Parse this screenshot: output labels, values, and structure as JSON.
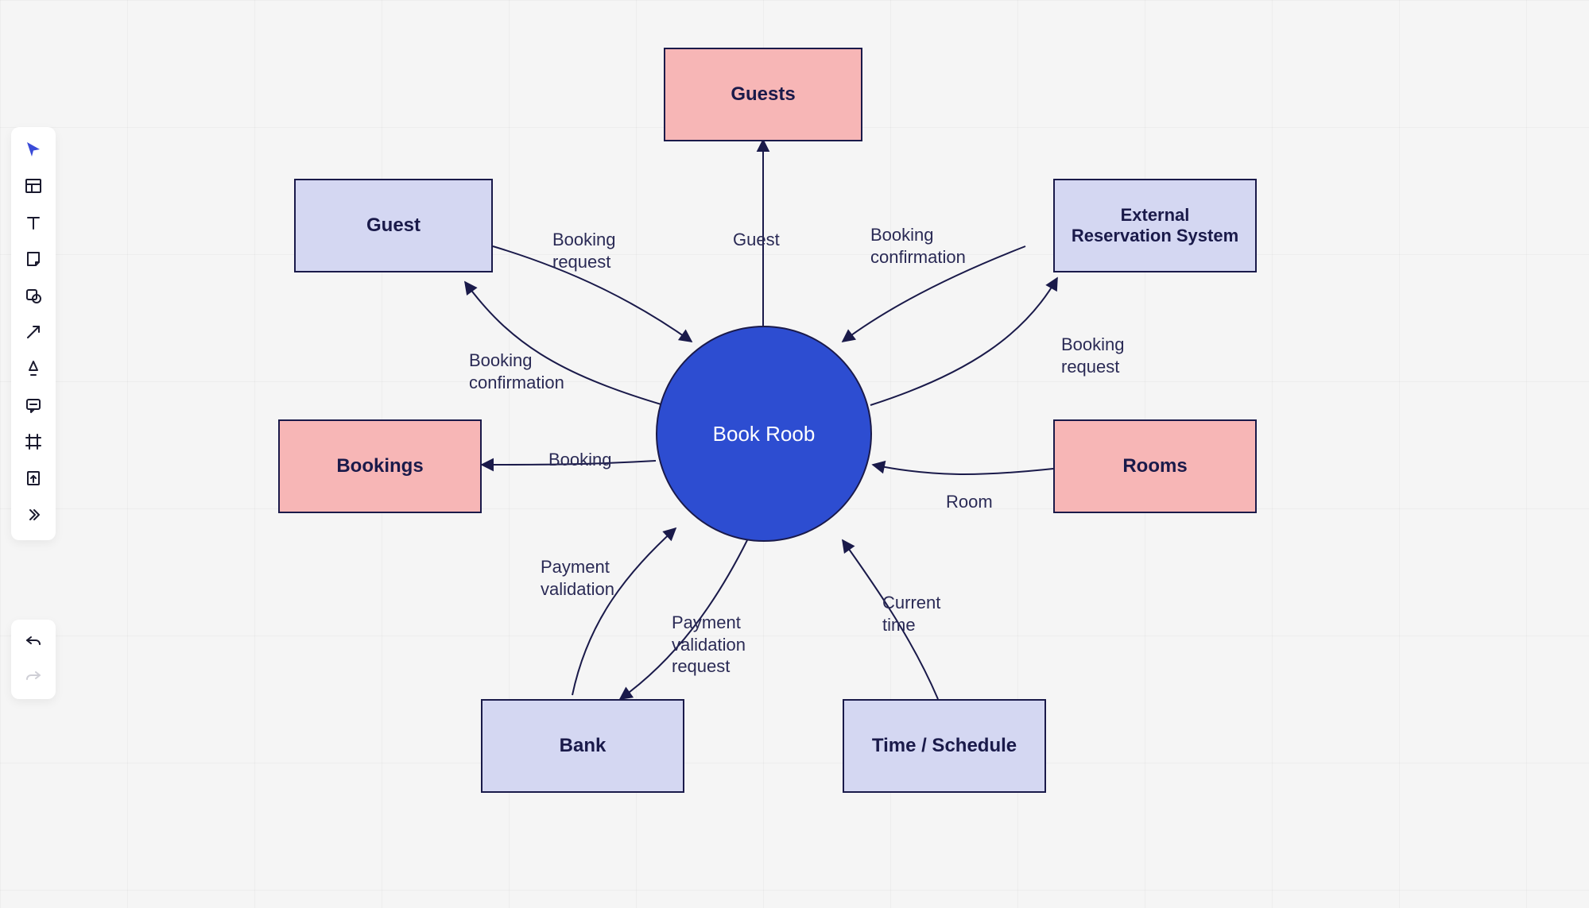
{
  "diagram": {
    "center": "Book Roob",
    "nodes": {
      "guest": "Guest",
      "guests": "Guests",
      "external": "External\nReservation System",
      "rooms": "Rooms",
      "bookings": "Bookings",
      "bank": "Bank",
      "time": "Time / Schedule"
    },
    "edge_labels": {
      "guest_out": "Booking\nrequest",
      "guest_in": "Booking\nconfirmation",
      "guests_edge": "Guest",
      "ext_out": "Booking\nrequest",
      "ext_in": "Booking\nconfirmation",
      "rooms_edge": "Room",
      "bookings_edge": "Booking",
      "bank_in": "Payment\nvalidation\nrequest",
      "bank_out": "Payment\nvalidation",
      "time_edge": "Current\ntime"
    }
  },
  "toolbar": {
    "tools": [
      {
        "name": "pointer",
        "svg": "cursor"
      },
      {
        "name": "container",
        "svg": "layout"
      },
      {
        "name": "text",
        "svg": "text"
      },
      {
        "name": "note",
        "svg": "note"
      },
      {
        "name": "shape",
        "svg": "shape"
      },
      {
        "name": "arrow",
        "svg": "arrow"
      },
      {
        "name": "highlight",
        "svg": "highlight"
      },
      {
        "name": "comment",
        "svg": "comment"
      },
      {
        "name": "frame",
        "svg": "frame"
      },
      {
        "name": "export",
        "svg": "export"
      },
      {
        "name": "more",
        "svg": "more"
      }
    ]
  }
}
